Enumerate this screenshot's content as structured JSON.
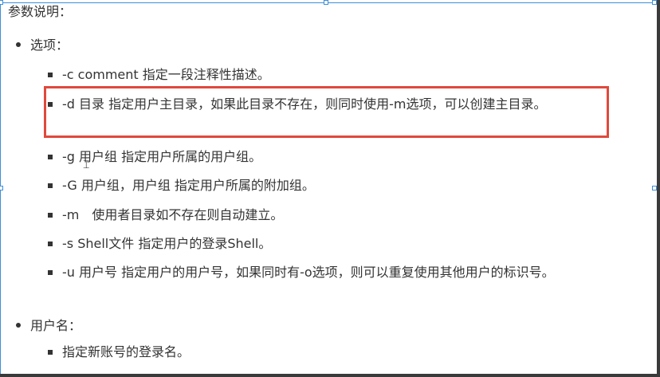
{
  "heading": "参数说明：",
  "sections": [
    {
      "label": "选项：",
      "items": [
        "-c comment 指定一段注释性描述。",
        "-d 目录 指定用户主目录，如果此目录不存在，则同时使用-m选项，可以创建主目录。",
        "-g 用户组 指定用户所属的用户组。",
        "-G 用户组，用户组 指定用户所属的附加组。",
        "-m　使用者目录如不存在则自动建立。",
        "-s Shell文件 指定用户的登录Shell。",
        "-u 用户号 指定用户的用户号，如果同时有-o选项，则可以重复使用其他用户的标识号。"
      ]
    },
    {
      "label": "用户名：",
      "items": [
        "指定新账号的登录名。"
      ]
    }
  ],
  "highlight_color": "#e0493d",
  "selection_color": "#3d8fd9",
  "cursor_icon": "text-cursor-icon"
}
